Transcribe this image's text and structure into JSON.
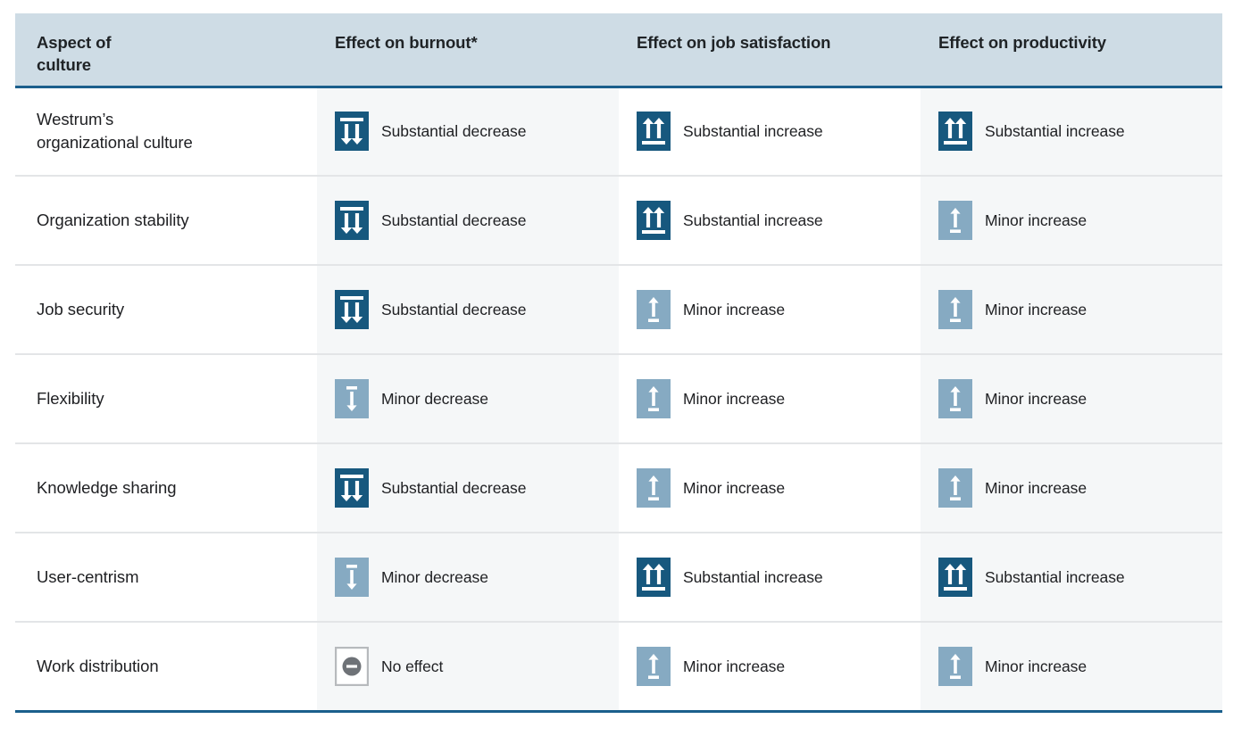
{
  "table": {
    "columns": [
      {
        "key": "aspect",
        "label": "Aspect of\nculture",
        "label_line1": "Aspect of",
        "label_line2": "culture"
      },
      {
        "key": "burnout",
        "label": "Effect on burnout*"
      },
      {
        "key": "jobsat",
        "label": "Effect on job satisfaction"
      },
      {
        "key": "productivity",
        "label": "Effect on productivity"
      }
    ],
    "rows": [
      {
        "aspect_line1": "Westrum’s",
        "aspect_line2": "organizational culture",
        "aspect": "Westrum’s organizational culture",
        "burnout": {
          "icon": "substantial-decrease-icon",
          "label": "Substantial decrease"
        },
        "jobsat": {
          "icon": "substantial-increase-icon",
          "label": "Substantial increase"
        },
        "productivity": {
          "icon": "substantial-increase-icon",
          "label": "Substantial increase"
        }
      },
      {
        "aspect_line1": "Organization stability",
        "aspect_line2": "",
        "aspect": "Organization stability",
        "burnout": {
          "icon": "substantial-decrease-icon",
          "label": "Substantial decrease"
        },
        "jobsat": {
          "icon": "substantial-increase-icon",
          "label": "Substantial increase"
        },
        "productivity": {
          "icon": "minor-increase-icon",
          "label": "Minor increase"
        }
      },
      {
        "aspect_line1": "Job security",
        "aspect_line2": "",
        "aspect": "Job security",
        "burnout": {
          "icon": "substantial-decrease-icon",
          "label": "Substantial decrease"
        },
        "jobsat": {
          "icon": "minor-increase-icon",
          "label": "Minor increase"
        },
        "productivity": {
          "icon": "minor-increase-icon",
          "label": "Minor increase"
        }
      },
      {
        "aspect_line1": "Flexibility",
        "aspect_line2": "",
        "aspect": "Flexibility",
        "burnout": {
          "icon": "minor-decrease-icon",
          "label": "Minor decrease"
        },
        "jobsat": {
          "icon": "minor-increase-icon",
          "label": "Minor increase"
        },
        "productivity": {
          "icon": "minor-increase-icon",
          "label": "Minor increase"
        }
      },
      {
        "aspect_line1": "Knowledge sharing",
        "aspect_line2": "",
        "aspect": "Knowledge sharing",
        "burnout": {
          "icon": "substantial-decrease-icon",
          "label": "Substantial decrease"
        },
        "jobsat": {
          "icon": "minor-increase-icon",
          "label": "Minor increase"
        },
        "productivity": {
          "icon": "minor-increase-icon",
          "label": "Minor increase"
        }
      },
      {
        "aspect_line1": "User-centrism",
        "aspect_line2": "",
        "aspect": "User-centrism",
        "burnout": {
          "icon": "minor-decrease-icon",
          "label": "Minor decrease"
        },
        "jobsat": {
          "icon": "substantial-increase-icon",
          "label": "Substantial increase"
        },
        "productivity": {
          "icon": "substantial-increase-icon",
          "label": "Substantial increase"
        }
      },
      {
        "aspect_line1": "Work distribution",
        "aspect_line2": "",
        "aspect": "Work distribution",
        "burnout": {
          "icon": "no-effect-icon",
          "label": "No effect"
        },
        "jobsat": {
          "icon": "minor-increase-icon",
          "label": "Minor increase"
        },
        "productivity": {
          "icon": "minor-increase-icon",
          "label": "Minor increase"
        }
      }
    ]
  },
  "colors": {
    "header_background": "#cedce5",
    "rule_blue": "#1b5f8c",
    "icon_strong_blue": "#17587e",
    "icon_light_blue": "#86aac2",
    "icon_no_effect_gray": "#6e7277",
    "column_tint": "#f5f7f8",
    "row_divider": "#e3e5e7",
    "text": "#202124"
  }
}
